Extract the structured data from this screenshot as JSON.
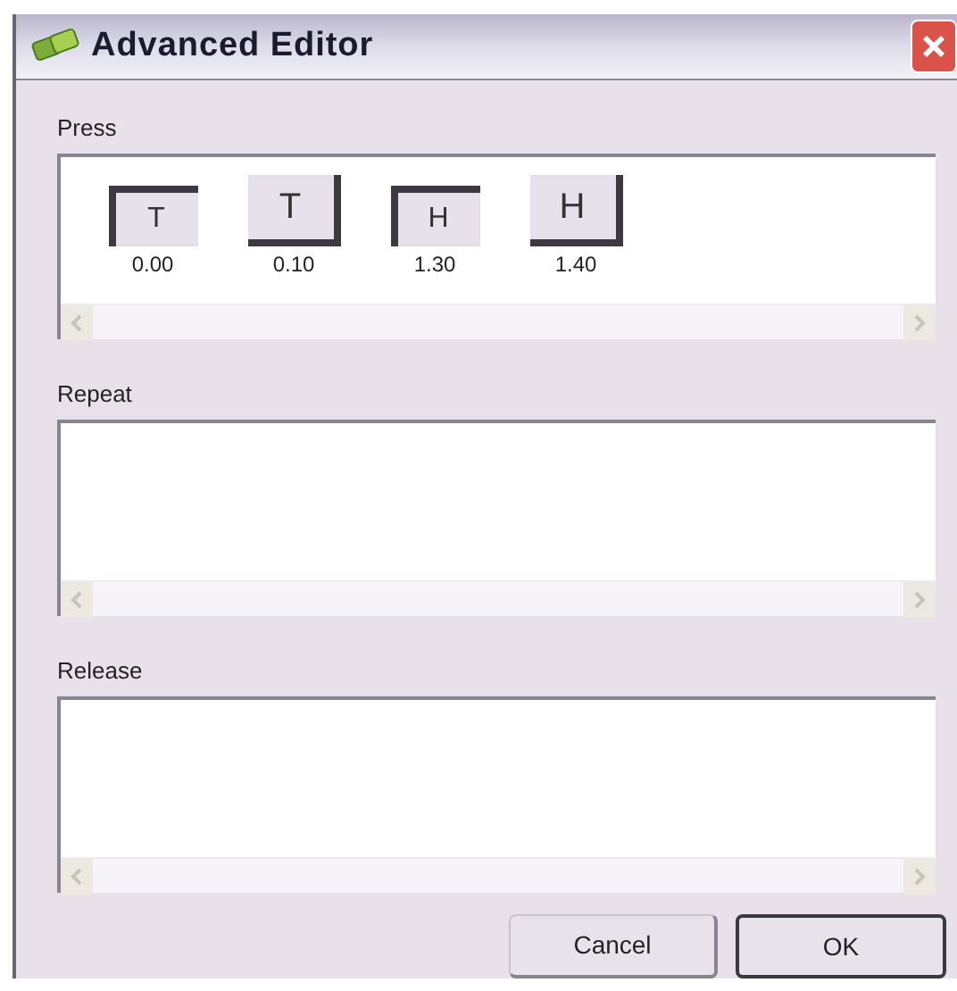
{
  "window": {
    "title": "Advanced Editor"
  },
  "sections": [
    {
      "label": "Press",
      "keys": [
        {
          "key": "T",
          "time": "0.00",
          "pressed": true
        },
        {
          "key": "T",
          "time": "0.10",
          "pressed": false
        },
        {
          "key": "H",
          "time": "1.30",
          "pressed": true
        },
        {
          "key": "H",
          "time": "1.40",
          "pressed": false
        }
      ]
    },
    {
      "label": "Repeat"
    },
    {
      "label": "Release"
    }
  ],
  "buttons": [
    {
      "label": "Cancel",
      "default": false
    },
    {
      "label": "OK",
      "default": true
    }
  ]
}
